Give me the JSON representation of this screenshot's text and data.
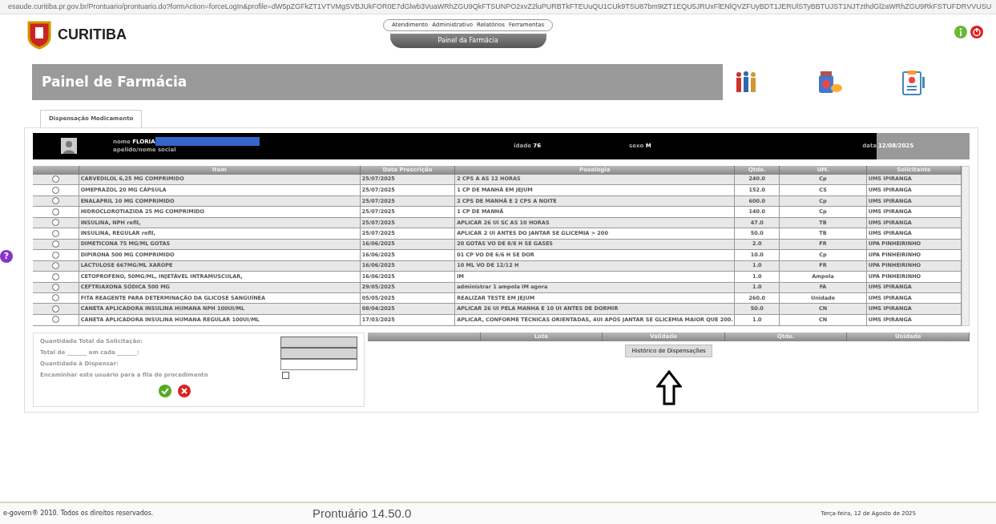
{
  "browser": {
    "url": "esaude.curitiba.pr.gov.br/Prontuario/prontuario.do?formAction=forceLogIn&profile=dW5pZGFkZT1VTVMgSVBJUkFOR0E7dGlwb3VuaWRhZGU9QkFTSUNPO2xvZ2luPURBTkFTEUuQU1CUk9TSU87bm9tZT1EQU5JRUxFlENlQVZFUyBDT1JERUlSTyBBTUJST1NJTzthdGl2aWRhZGU9RkFSTUFDRVVUSU"
  },
  "header": {
    "logo_text": "CURITIBA",
    "menu": [
      "Atendimento",
      "Administrativo",
      "Relatórios",
      "Ferramentas"
    ],
    "module_tab": "Painel da Farmácia"
  },
  "page_title": "Painel de Farmácia",
  "tabs": [
    {
      "label": "Dispensação Medicamento",
      "selected": true
    }
  ],
  "patient": {
    "name_label": "nome",
    "name": "FLORIA",
    "nickname_label": "apelido/nome social",
    "age_label": "idade",
    "age": "76",
    "sex_label": "sexo",
    "sex": "M",
    "date_label": "data",
    "date": "12/08/2025"
  },
  "prescriptions": {
    "columns": [
      "Item",
      "Data Prescrição",
      "Posologia",
      "Qtde.",
      "UM.",
      "Solicitante"
    ],
    "rows": [
      {
        "selected": false,
        "item": "CARVEDILOL 6,25 MG COMPRIMIDO",
        "date": "25/07/2025",
        "posology": "2 CPS A AS 12 HORAS",
        "qty": "240.0",
        "unit": "Cp",
        "requester": "UMS IPIRANGA"
      },
      {
        "selected": false,
        "item": "OMEPRAZOL 20 MG CÁPSULA",
        "date": "25/07/2025",
        "posology": "1 CP DE MANHÃ EM JEJUM",
        "qty": "152.0",
        "unit": "CS",
        "requester": "UMS IPIRANGA"
      },
      {
        "selected": false,
        "item": "ENALAPRIL 10 MG COMPRIMIDO",
        "date": "25/07/2025",
        "posology": "2 CPS DE MANHÃ E 2 CPS A NOITE",
        "qty": "600.0",
        "unit": "Cp",
        "requester": "UMS IPIRANGA"
      },
      {
        "selected": false,
        "item": "HIDROCLOROTIAZIDA 25 MG COMPRIMIDO",
        "date": "25/07/2025",
        "posology": "1 CP DE MANHÃ",
        "qty": "140.0",
        "unit": "Cp",
        "requester": "UMS IPIRANGA"
      },
      {
        "selected": false,
        "item": "INSULINA, NPH refil,",
        "date": "25/07/2025",
        "posology": "APLICAR 26 UI SC AS 10 HORAS",
        "qty": "47.0",
        "unit": "TB",
        "requester": "UMS IPIRANGA"
      },
      {
        "selected": false,
        "item": "INSULINA, REGULAR refil,",
        "date": "25/07/2025",
        "posology": "APLICAR 2 UI ANTES DO JANTAR SE GLICEMIA > 200",
        "qty": "50.0",
        "unit": "TB",
        "requester": "UMS IPIRANGA"
      },
      {
        "selected": false,
        "item": "DIMETICONA 75 MG/ML GOTAS",
        "date": "16/06/2025",
        "posology": "20 GOTAS VO DE 8/8 H SE GASES",
        "qty": "2.0",
        "unit": "FR",
        "requester": "UPA PINHEIRINHO"
      },
      {
        "selected": false,
        "item": "DIPIRONA 500 MG COMPRIMIDO",
        "date": "16/06/2025",
        "posology": "01 CP VO DE 6/6 H SE DOR",
        "qty": "10.0",
        "unit": "Cp",
        "requester": "UPA PINHEIRINHO"
      },
      {
        "selected": false,
        "item": "LACTULOSE 667MG/ML XAROPE",
        "date": "16/06/2025",
        "posology": "10 ML VO DE 12/12 H",
        "qty": "1.0",
        "unit": "FR",
        "requester": "UPA PINHEIRINHO"
      },
      {
        "selected": false,
        "item": "CETOPROFENO, 50MG/ML, INJETÁVEL INTRAMUSCULAR,",
        "date": "16/06/2025",
        "posology": "IM",
        "qty": "1.0",
        "unit": "Ampola",
        "requester": "UPA PINHEIRINHO"
      },
      {
        "selected": false,
        "item": "CEFTRIAXONA SÓDICA 500 MG",
        "date": "29/05/2025",
        "posology": "administrar 1 ampola IM agora",
        "qty": "1.0",
        "unit": "FA",
        "requester": "UMS IPIRANGA"
      },
      {
        "selected": false,
        "item": "FITA REAGENTE PARA DETERMINAÇÃO DA GLICOSE SANGUÍNEA",
        "date": "05/05/2025",
        "posology": "REALIZAR TESTE EM JEJUM",
        "qty": "260.0",
        "unit": "Unidade",
        "requester": "UMS IPIRANGA"
      },
      {
        "selected": false,
        "item": "CANETA APLICADORA INSULINA HUMANA NPH 100UI/ML",
        "date": "08/04/2025",
        "posology": "APLICAR 26 UI PELA MANHA E 10 UI ANTES DE DORMIR",
        "qty": "50.0",
        "unit": "CN",
        "requester": "UMS IPIRANGA"
      },
      {
        "selected": false,
        "item": "CANETA APLICADORA INSULINA HUMANA REGULAR 100UI/ML",
        "date": "17/03/2025",
        "posology": "APLICAR, CONFORME TÉCNICAS ORIENTADAS, 4UI APÓS JANTAR SE GLICEMIA MAIOR QUE 200.",
        "qty": "1.0",
        "unit": "CN",
        "requester": "UMS IPIRANGA"
      }
    ]
  },
  "form": {
    "fields": [
      {
        "kind": "input",
        "label": "Quantidade Total da Solicitação:",
        "disabled": true
      },
      {
        "kind": "input",
        "label": "Total de _______ em cada _______:",
        "disabled": true
      },
      {
        "kind": "input",
        "label": "Quantidade à  Dispensar:",
        "disabled": false
      },
      {
        "kind": "checkbox",
        "label": "Encaminhar este usuário para a fila de procedimento",
        "checked": false
      }
    ]
  },
  "lot_table": {
    "columns": [
      "Lote",
      "Validade",
      "Qtde.",
      "Unidade"
    ]
  },
  "history_button": "Histórico de Dispensações",
  "help_button": "?",
  "footer": {
    "copyright": "e-govern® 2010. Todos os direitos reservados.",
    "version": "Prontuário 14.50.0",
    "date": "Terça-feira, 12 de Agosto de 2025"
  }
}
